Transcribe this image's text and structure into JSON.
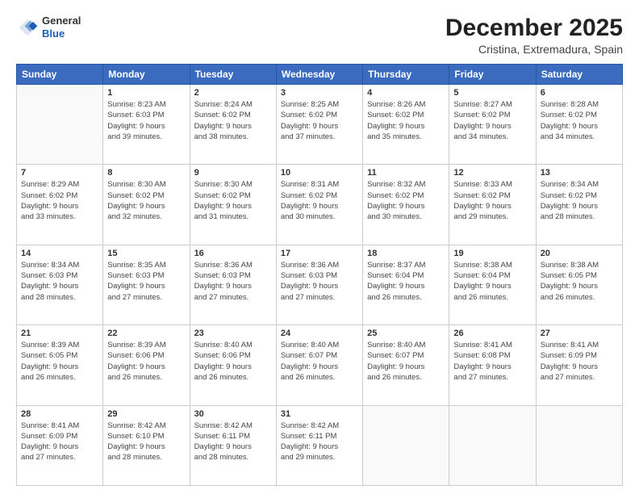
{
  "header": {
    "logo_line1": "General",
    "logo_line2": "Blue",
    "month": "December 2025",
    "location": "Cristina, Extremadura, Spain"
  },
  "weekdays": [
    "Sunday",
    "Monday",
    "Tuesday",
    "Wednesday",
    "Thursday",
    "Friday",
    "Saturday"
  ],
  "weeks": [
    [
      {
        "day": "",
        "info": ""
      },
      {
        "day": "1",
        "info": "Sunrise: 8:23 AM\nSunset: 6:03 PM\nDaylight: 9 hours\nand 39 minutes."
      },
      {
        "day": "2",
        "info": "Sunrise: 8:24 AM\nSunset: 6:02 PM\nDaylight: 9 hours\nand 38 minutes."
      },
      {
        "day": "3",
        "info": "Sunrise: 8:25 AM\nSunset: 6:02 PM\nDaylight: 9 hours\nand 37 minutes."
      },
      {
        "day": "4",
        "info": "Sunrise: 8:26 AM\nSunset: 6:02 PM\nDaylight: 9 hours\nand 35 minutes."
      },
      {
        "day": "5",
        "info": "Sunrise: 8:27 AM\nSunset: 6:02 PM\nDaylight: 9 hours\nand 34 minutes."
      },
      {
        "day": "6",
        "info": "Sunrise: 8:28 AM\nSunset: 6:02 PM\nDaylight: 9 hours\nand 34 minutes."
      }
    ],
    [
      {
        "day": "7",
        "info": "Sunrise: 8:29 AM\nSunset: 6:02 PM\nDaylight: 9 hours\nand 33 minutes."
      },
      {
        "day": "8",
        "info": "Sunrise: 8:30 AM\nSunset: 6:02 PM\nDaylight: 9 hours\nand 32 minutes."
      },
      {
        "day": "9",
        "info": "Sunrise: 8:30 AM\nSunset: 6:02 PM\nDaylight: 9 hours\nand 31 minutes."
      },
      {
        "day": "10",
        "info": "Sunrise: 8:31 AM\nSunset: 6:02 PM\nDaylight: 9 hours\nand 30 minutes."
      },
      {
        "day": "11",
        "info": "Sunrise: 8:32 AM\nSunset: 6:02 PM\nDaylight: 9 hours\nand 30 minutes."
      },
      {
        "day": "12",
        "info": "Sunrise: 8:33 AM\nSunset: 6:02 PM\nDaylight: 9 hours\nand 29 minutes."
      },
      {
        "day": "13",
        "info": "Sunrise: 8:34 AM\nSunset: 6:02 PM\nDaylight: 9 hours\nand 28 minutes."
      }
    ],
    [
      {
        "day": "14",
        "info": "Sunrise: 8:34 AM\nSunset: 6:03 PM\nDaylight: 9 hours\nand 28 minutes."
      },
      {
        "day": "15",
        "info": "Sunrise: 8:35 AM\nSunset: 6:03 PM\nDaylight: 9 hours\nand 27 minutes."
      },
      {
        "day": "16",
        "info": "Sunrise: 8:36 AM\nSunset: 6:03 PM\nDaylight: 9 hours\nand 27 minutes."
      },
      {
        "day": "17",
        "info": "Sunrise: 8:36 AM\nSunset: 6:03 PM\nDaylight: 9 hours\nand 27 minutes."
      },
      {
        "day": "18",
        "info": "Sunrise: 8:37 AM\nSunset: 6:04 PM\nDaylight: 9 hours\nand 26 minutes."
      },
      {
        "day": "19",
        "info": "Sunrise: 8:38 AM\nSunset: 6:04 PM\nDaylight: 9 hours\nand 26 minutes."
      },
      {
        "day": "20",
        "info": "Sunrise: 8:38 AM\nSunset: 6:05 PM\nDaylight: 9 hours\nand 26 minutes."
      }
    ],
    [
      {
        "day": "21",
        "info": "Sunrise: 8:39 AM\nSunset: 6:05 PM\nDaylight: 9 hours\nand 26 minutes."
      },
      {
        "day": "22",
        "info": "Sunrise: 8:39 AM\nSunset: 6:06 PM\nDaylight: 9 hours\nand 26 minutes."
      },
      {
        "day": "23",
        "info": "Sunrise: 8:40 AM\nSunset: 6:06 PM\nDaylight: 9 hours\nand 26 minutes."
      },
      {
        "day": "24",
        "info": "Sunrise: 8:40 AM\nSunset: 6:07 PM\nDaylight: 9 hours\nand 26 minutes."
      },
      {
        "day": "25",
        "info": "Sunrise: 8:40 AM\nSunset: 6:07 PM\nDaylight: 9 hours\nand 26 minutes."
      },
      {
        "day": "26",
        "info": "Sunrise: 8:41 AM\nSunset: 6:08 PM\nDaylight: 9 hours\nand 27 minutes."
      },
      {
        "day": "27",
        "info": "Sunrise: 8:41 AM\nSunset: 6:09 PM\nDaylight: 9 hours\nand 27 minutes."
      }
    ],
    [
      {
        "day": "28",
        "info": "Sunrise: 8:41 AM\nSunset: 6:09 PM\nDaylight: 9 hours\nand 27 minutes."
      },
      {
        "day": "29",
        "info": "Sunrise: 8:42 AM\nSunset: 6:10 PM\nDaylight: 9 hours\nand 28 minutes."
      },
      {
        "day": "30",
        "info": "Sunrise: 8:42 AM\nSunset: 6:11 PM\nDaylight: 9 hours\nand 28 minutes."
      },
      {
        "day": "31",
        "info": "Sunrise: 8:42 AM\nSunset: 6:11 PM\nDaylight: 9 hours\nand 29 minutes."
      },
      {
        "day": "",
        "info": ""
      },
      {
        "day": "",
        "info": ""
      },
      {
        "day": "",
        "info": ""
      }
    ]
  ]
}
